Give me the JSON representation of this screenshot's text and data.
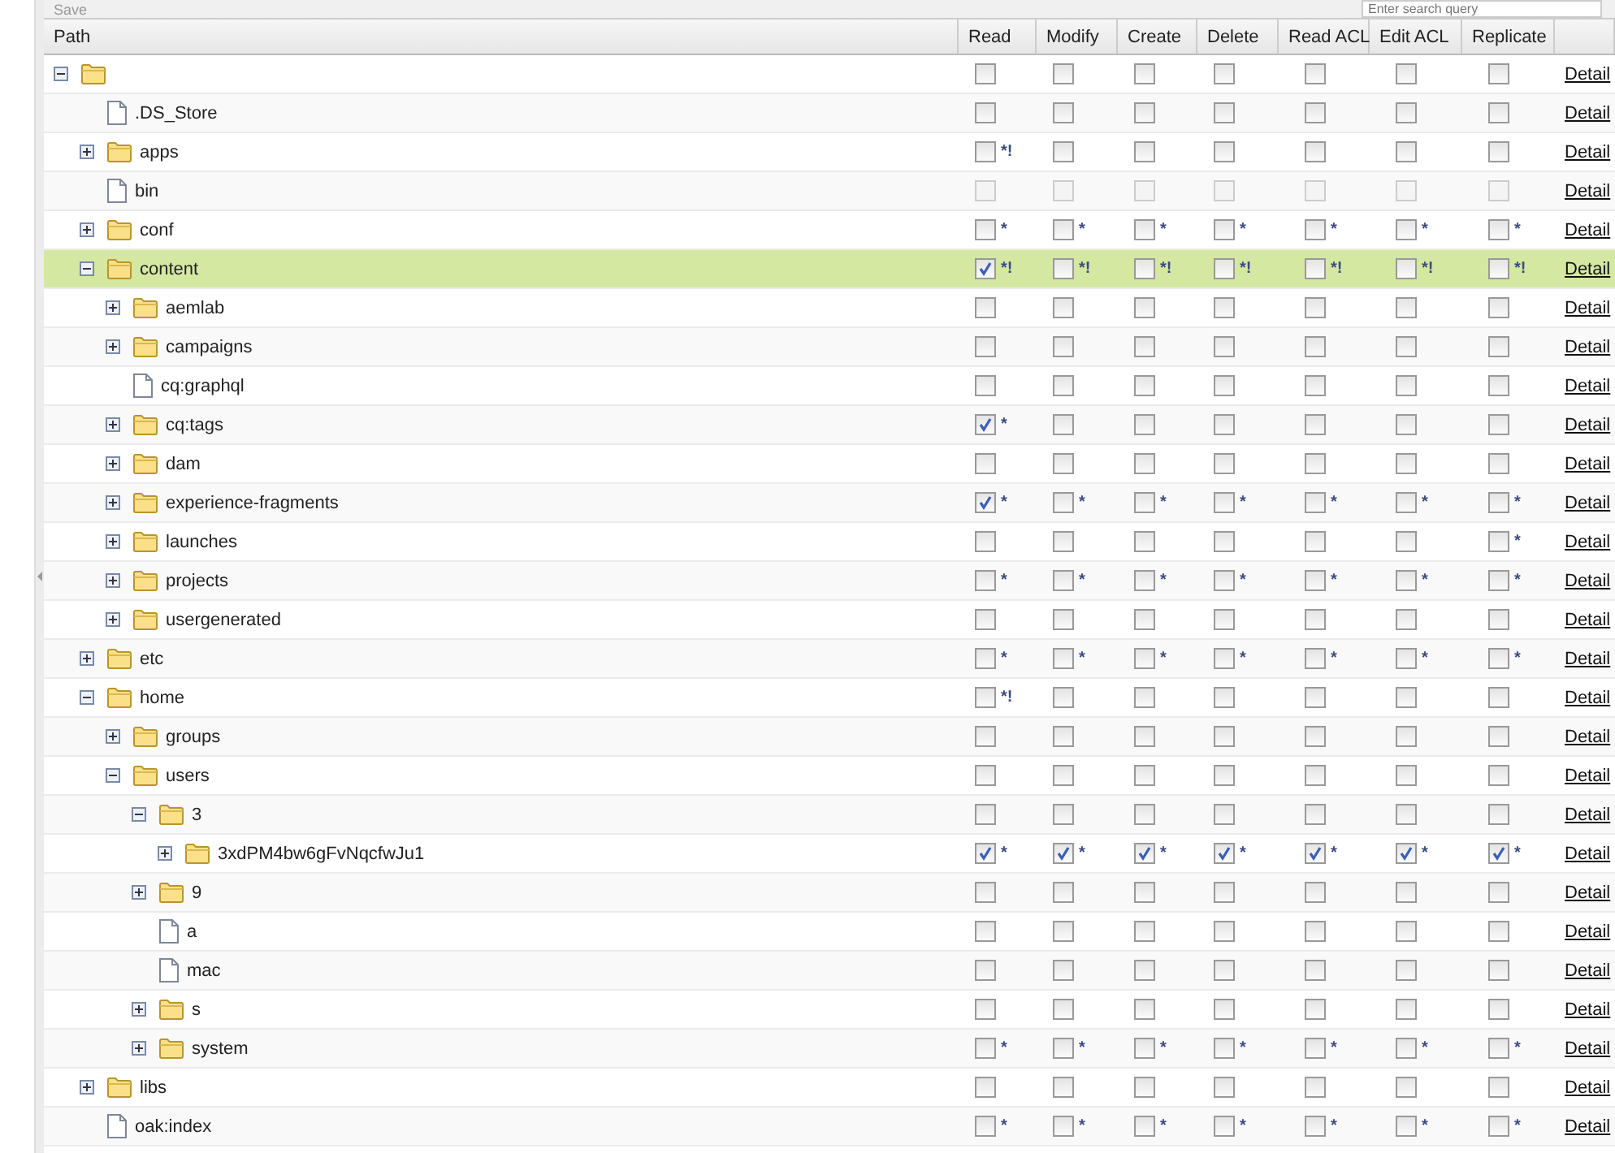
{
  "toolbar": {
    "save_label": "Save",
    "search": {
      "placeholder": "Enter search query"
    }
  },
  "table": {
    "columns": [
      "Path",
      "Read",
      "Modify",
      "Create",
      "Delete",
      "Read ACL",
      "Edit ACL",
      "Replicate"
    ],
    "tree": [
      {
        "kind": "folder",
        "expanded": true,
        "selected": false,
        "detail": "Detail",
        "perms": [
          {
            "checked": false
          },
          {
            "checked": false
          },
          {
            "checked": false
          },
          {
            "checked": false
          },
          {
            "checked": false
          },
          {
            "checked": false
          },
          {
            "checked": false
          }
        ],
        "children": [
          {
            "name": ".DS_Store",
            "kind": "file",
            "selected": false,
            "detail": "Detail",
            "perms": [
              {
                "checked": false
              },
              {
                "checked": false
              },
              {
                "checked": false
              },
              {
                "checked": false
              },
              {
                "checked": false
              },
              {
                "checked": false
              },
              {
                "checked": false
              }
            ]
          },
          {
            "name": "apps",
            "kind": "folder",
            "expanded": false,
            "selected": false,
            "detail": "Detail",
            "perms": [
              {
                "checked": false,
                "mark": "*!"
              },
              {
                "checked": false
              },
              {
                "checked": false
              },
              {
                "checked": false
              },
              {
                "checked": false
              },
              {
                "checked": false
              },
              {
                "checked": false
              }
            ]
          },
          {
            "name": "bin",
            "kind": "file",
            "selected": false,
            "disabled": true,
            "detail": "Detail",
            "perms": [
              {
                "checked": false
              },
              {
                "checked": false
              },
              {
                "checked": false
              },
              {
                "checked": false
              },
              {
                "checked": false
              },
              {
                "checked": false
              },
              {
                "checked": false
              }
            ]
          },
          {
            "name": "conf",
            "kind": "folder",
            "expanded": false,
            "selected": false,
            "detail": "Detail",
            "perms": [
              {
                "checked": false,
                "mark": "*"
              },
              {
                "checked": false,
                "mark": "*"
              },
              {
                "checked": false,
                "mark": "*"
              },
              {
                "checked": false,
                "mark": "*"
              },
              {
                "checked": false,
                "mark": "*"
              },
              {
                "checked": false,
                "mark": "*"
              },
              {
                "checked": false,
                "mark": "*"
              }
            ]
          },
          {
            "name": "content",
            "kind": "folder",
            "expanded": true,
            "selected": true,
            "detail": "Detail",
            "perms": [
              {
                "checked": true,
                "mark": "*!"
              },
              {
                "checked": false,
                "mark": "*!"
              },
              {
                "checked": false,
                "mark": "*!"
              },
              {
                "checked": false,
                "mark": "*!"
              },
              {
                "checked": false,
                "mark": "*!"
              },
              {
                "checked": false,
                "mark": "*!"
              },
              {
                "checked": false,
                "mark": "*!"
              }
            ],
            "children": [
              {
                "name": "aemlab",
                "kind": "folder",
                "expanded": false,
                "selected": false,
                "detail": "Detail",
                "perms": [
                  {
                    "checked": false
                  },
                  {
                    "checked": false
                  },
                  {
                    "checked": false
                  },
                  {
                    "checked": false
                  },
                  {
                    "checked": false
                  },
                  {
                    "checked": false
                  },
                  {
                    "checked": false
                  }
                ]
              },
              {
                "name": "campaigns",
                "kind": "folder",
                "expanded": false,
                "selected": false,
                "detail": "Detail",
                "perms": [
                  {
                    "checked": false
                  },
                  {
                    "checked": false
                  },
                  {
                    "checked": false
                  },
                  {
                    "checked": false
                  },
                  {
                    "checked": false
                  },
                  {
                    "checked": false
                  },
                  {
                    "checked": false
                  }
                ]
              },
              {
                "name": "cq:graphql",
                "kind": "file",
                "selected": false,
                "detail": "Detail",
                "perms": [
                  {
                    "checked": false
                  },
                  {
                    "checked": false
                  },
                  {
                    "checked": false
                  },
                  {
                    "checked": false
                  },
                  {
                    "checked": false
                  },
                  {
                    "checked": false
                  },
                  {
                    "checked": false
                  }
                ]
              },
              {
                "name": "cq:tags",
                "kind": "folder",
                "expanded": false,
                "selected": false,
                "detail": "Detail",
                "perms": [
                  {
                    "checked": true,
                    "mark": "*"
                  },
                  {
                    "checked": false
                  },
                  {
                    "checked": false
                  },
                  {
                    "checked": false
                  },
                  {
                    "checked": false
                  },
                  {
                    "checked": false
                  },
                  {
                    "checked": false
                  }
                ]
              },
              {
                "name": "dam",
                "kind": "folder",
                "expanded": false,
                "selected": false,
                "detail": "Detail",
                "perms": [
                  {
                    "checked": false
                  },
                  {
                    "checked": false
                  },
                  {
                    "checked": false
                  },
                  {
                    "checked": false
                  },
                  {
                    "checked": false
                  },
                  {
                    "checked": false
                  },
                  {
                    "checked": false
                  }
                ]
              },
              {
                "name": "experience-fragments",
                "kind": "folder",
                "expanded": false,
                "selected": false,
                "detail": "Detail",
                "perms": [
                  {
                    "checked": true,
                    "mark": "*"
                  },
                  {
                    "checked": false,
                    "mark": "*"
                  },
                  {
                    "checked": false,
                    "mark": "*"
                  },
                  {
                    "checked": false,
                    "mark": "*"
                  },
                  {
                    "checked": false,
                    "mark": "*"
                  },
                  {
                    "checked": false,
                    "mark": "*"
                  },
                  {
                    "checked": false,
                    "mark": "*"
                  }
                ]
              },
              {
                "name": "launches",
                "kind": "folder",
                "expanded": false,
                "selected": false,
                "detail": "Detail",
                "perms": [
                  {
                    "checked": false
                  },
                  {
                    "checked": false
                  },
                  {
                    "checked": false
                  },
                  {
                    "checked": false
                  },
                  {
                    "checked": false
                  },
                  {
                    "checked": false
                  },
                  {
                    "checked": false,
                    "mark": "*"
                  }
                ]
              },
              {
                "name": "projects",
                "kind": "folder",
                "expanded": false,
                "selected": false,
                "detail": "Detail",
                "perms": [
                  {
                    "checked": false,
                    "mark": "*"
                  },
                  {
                    "checked": false,
                    "mark": "*"
                  },
                  {
                    "checked": false,
                    "mark": "*"
                  },
                  {
                    "checked": false,
                    "mark": "*"
                  },
                  {
                    "checked": false,
                    "mark": "*"
                  },
                  {
                    "checked": false,
                    "mark": "*"
                  },
                  {
                    "checked": false,
                    "mark": "*"
                  }
                ]
              },
              {
                "name": "usergenerated",
                "kind": "folder",
                "expanded": false,
                "selected": false,
                "detail": "Detail",
                "perms": [
                  {
                    "checked": false
                  },
                  {
                    "checked": false
                  },
                  {
                    "checked": false
                  },
                  {
                    "checked": false
                  },
                  {
                    "checked": false
                  },
                  {
                    "checked": false
                  },
                  {
                    "checked": false
                  }
                ]
              }
            ]
          },
          {
            "name": "etc",
            "kind": "folder",
            "expanded": false,
            "selected": false,
            "detail": "Detail",
            "perms": [
              {
                "checked": false,
                "mark": "*"
              },
              {
                "checked": false,
                "mark": "*"
              },
              {
                "checked": false,
                "mark": "*"
              },
              {
                "checked": false,
                "mark": "*"
              },
              {
                "checked": false,
                "mark": "*"
              },
              {
                "checked": false,
                "mark": "*"
              },
              {
                "checked": false,
                "mark": "*"
              }
            ]
          },
          {
            "name": "home",
            "kind": "folder",
            "expanded": true,
            "selected": false,
            "detail": "Detail",
            "perms": [
              {
                "checked": false,
                "mark": "*!"
              },
              {
                "checked": false
              },
              {
                "checked": false
              },
              {
                "checked": false
              },
              {
                "checked": false
              },
              {
                "checked": false
              },
              {
                "checked": false
              }
            ],
            "children": [
              {
                "name": "groups",
                "kind": "folder",
                "expanded": false,
                "selected": false,
                "detail": "Detail",
                "perms": [
                  {
                    "checked": false
                  },
                  {
                    "checked": false
                  },
                  {
                    "checked": false
                  },
                  {
                    "checked": false
                  },
                  {
                    "checked": false
                  },
                  {
                    "checked": false
                  },
                  {
                    "checked": false
                  }
                ]
              },
              {
                "name": "users",
                "kind": "folder",
                "expanded": true,
                "selected": false,
                "detail": "Detail",
                "perms": [
                  {
                    "checked": false
                  },
                  {
                    "checked": false
                  },
                  {
                    "checked": false
                  },
                  {
                    "checked": false
                  },
                  {
                    "checked": false
                  },
                  {
                    "checked": false
                  },
                  {
                    "checked": false
                  }
                ],
                "children": [
                  {
                    "name": "3",
                    "kind": "folder",
                    "expanded": true,
                    "selected": false,
                    "detail": "Detail",
                    "perms": [
                      {
                        "checked": false
                      },
                      {
                        "checked": false
                      },
                      {
                        "checked": false
                      },
                      {
                        "checked": false
                      },
                      {
                        "checked": false
                      },
                      {
                        "checked": false
                      },
                      {
                        "checked": false
                      }
                    ],
                    "children": [
                      {
                        "name": "3xdPM4bw6gFvNqcfwJu1",
                        "kind": "folder",
                        "expanded": false,
                        "selected": false,
                        "detail": "Detail",
                        "perms": [
                          {
                            "checked": true,
                            "mark": "*"
                          },
                          {
                            "checked": true,
                            "mark": "*"
                          },
                          {
                            "checked": true,
                            "mark": "*"
                          },
                          {
                            "checked": true,
                            "mark": "*"
                          },
                          {
                            "checked": true,
                            "mark": "*"
                          },
                          {
                            "checked": true,
                            "mark": "*"
                          },
                          {
                            "checked": true,
                            "mark": "*"
                          }
                        ]
                      }
                    ]
                  },
                  {
                    "name": "9",
                    "kind": "folder",
                    "expanded": false,
                    "selected": false,
                    "detail": "Detail",
                    "perms": [
                      {
                        "checked": false
                      },
                      {
                        "checked": false
                      },
                      {
                        "checked": false
                      },
                      {
                        "checked": false
                      },
                      {
                        "checked": false
                      },
                      {
                        "checked": false
                      },
                      {
                        "checked": false
                      }
                    ]
                  },
                  {
                    "name": "a",
                    "kind": "file",
                    "selected": false,
                    "detail": "Detail",
                    "perms": [
                      {
                        "checked": false
                      },
                      {
                        "checked": false
                      },
                      {
                        "checked": false
                      },
                      {
                        "checked": false
                      },
                      {
                        "checked": false
                      },
                      {
                        "checked": false
                      },
                      {
                        "checked": false
                      }
                    ]
                  },
                  {
                    "name": "mac",
                    "kind": "file",
                    "selected": false,
                    "detail": "Detail",
                    "perms": [
                      {
                        "checked": false
                      },
                      {
                        "checked": false
                      },
                      {
                        "checked": false
                      },
                      {
                        "checked": false
                      },
                      {
                        "checked": false
                      },
                      {
                        "checked": false
                      },
                      {
                        "checked": false
                      }
                    ]
                  },
                  {
                    "name": "s",
                    "kind": "folder",
                    "expanded": false,
                    "selected": false,
                    "detail": "Detail",
                    "perms": [
                      {
                        "checked": false
                      },
                      {
                        "checked": false
                      },
                      {
                        "checked": false
                      },
                      {
                        "checked": false
                      },
                      {
                        "checked": false
                      },
                      {
                        "checked": false
                      },
                      {
                        "checked": false
                      }
                    ]
                  },
                  {
                    "name": "system",
                    "kind": "folder",
                    "expanded": false,
                    "selected": false,
                    "detail": "Detail",
                    "perms": [
                      {
                        "checked": false,
                        "mark": "*"
                      },
                      {
                        "checked": false,
                        "mark": "*"
                      },
                      {
                        "checked": false,
                        "mark": "*"
                      },
                      {
                        "checked": false,
                        "mark": "*"
                      },
                      {
                        "checked": false,
                        "mark": "*"
                      },
                      {
                        "checked": false,
                        "mark": "*"
                      },
                      {
                        "checked": false,
                        "mark": "*"
                      }
                    ]
                  }
                ]
              }
            ]
          },
          {
            "name": "libs",
            "kind": "folder",
            "expanded": false,
            "selected": false,
            "detail": "Detail",
            "perms": [
              {
                "checked": false
              },
              {
                "checked": false
              },
              {
                "checked": false
              },
              {
                "checked": false
              },
              {
                "checked": false
              },
              {
                "checked": false
              },
              {
                "checked": false
              }
            ]
          },
          {
            "name": "oak:index",
            "kind": "file",
            "selected": false,
            "detail": "Detail",
            "perms": [
              {
                "checked": false,
                "mark": "*"
              },
              {
                "checked": false,
                "mark": "*"
              },
              {
                "checked": false,
                "mark": "*"
              },
              {
                "checked": false,
                "mark": "*"
              },
              {
                "checked": false,
                "mark": "*"
              },
              {
                "checked": false,
                "mark": "*"
              },
              {
                "checked": false,
                "mark": "*"
              }
            ]
          }
        ]
      }
    ]
  }
}
